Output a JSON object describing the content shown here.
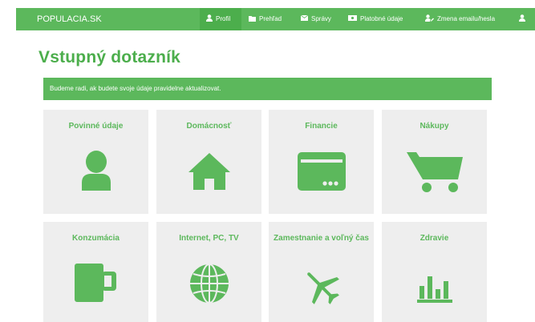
{
  "header": {
    "brand": "POPULACIA.SK",
    "nav": [
      {
        "label": "Profil",
        "icon": "user-icon",
        "active": true
      },
      {
        "label": "Prehľad",
        "icon": "folder-icon"
      },
      {
        "label": "Správy",
        "icon": "envelope-icon"
      },
      {
        "label": "Platobné údaje",
        "icon": "money-icon"
      },
      {
        "label": "Zmena emailu/hesla",
        "icon": "user-edit-icon"
      },
      {
        "label": "",
        "icon": "user-icon"
      }
    ]
  },
  "page": {
    "title": "Vstupný dotazník",
    "alert": "Budeme radi, ak budete svoje údaje pravidelne aktualizovat."
  },
  "tiles": [
    {
      "title": "Povinné údaje",
      "icon": "person-icon"
    },
    {
      "title": "Domácnosť",
      "icon": "home-icon"
    },
    {
      "title": "Financie",
      "icon": "credit-card-icon"
    },
    {
      "title": "Nákupy",
      "icon": "shopping-cart-icon"
    },
    {
      "title": "Konzumácia",
      "icon": "mug-icon"
    },
    {
      "title": "Internet, PC, TV",
      "icon": "globe-icon"
    },
    {
      "title": "Zamestnanie a voľný čas",
      "icon": "airplane-icon"
    },
    {
      "title": "Zdravie",
      "icon": "bar-chart-icon"
    }
  ],
  "colors": {
    "green": "#5cb85c",
    "green_dark": "#4cae4c",
    "tile_bg": "#eeeeee"
  }
}
